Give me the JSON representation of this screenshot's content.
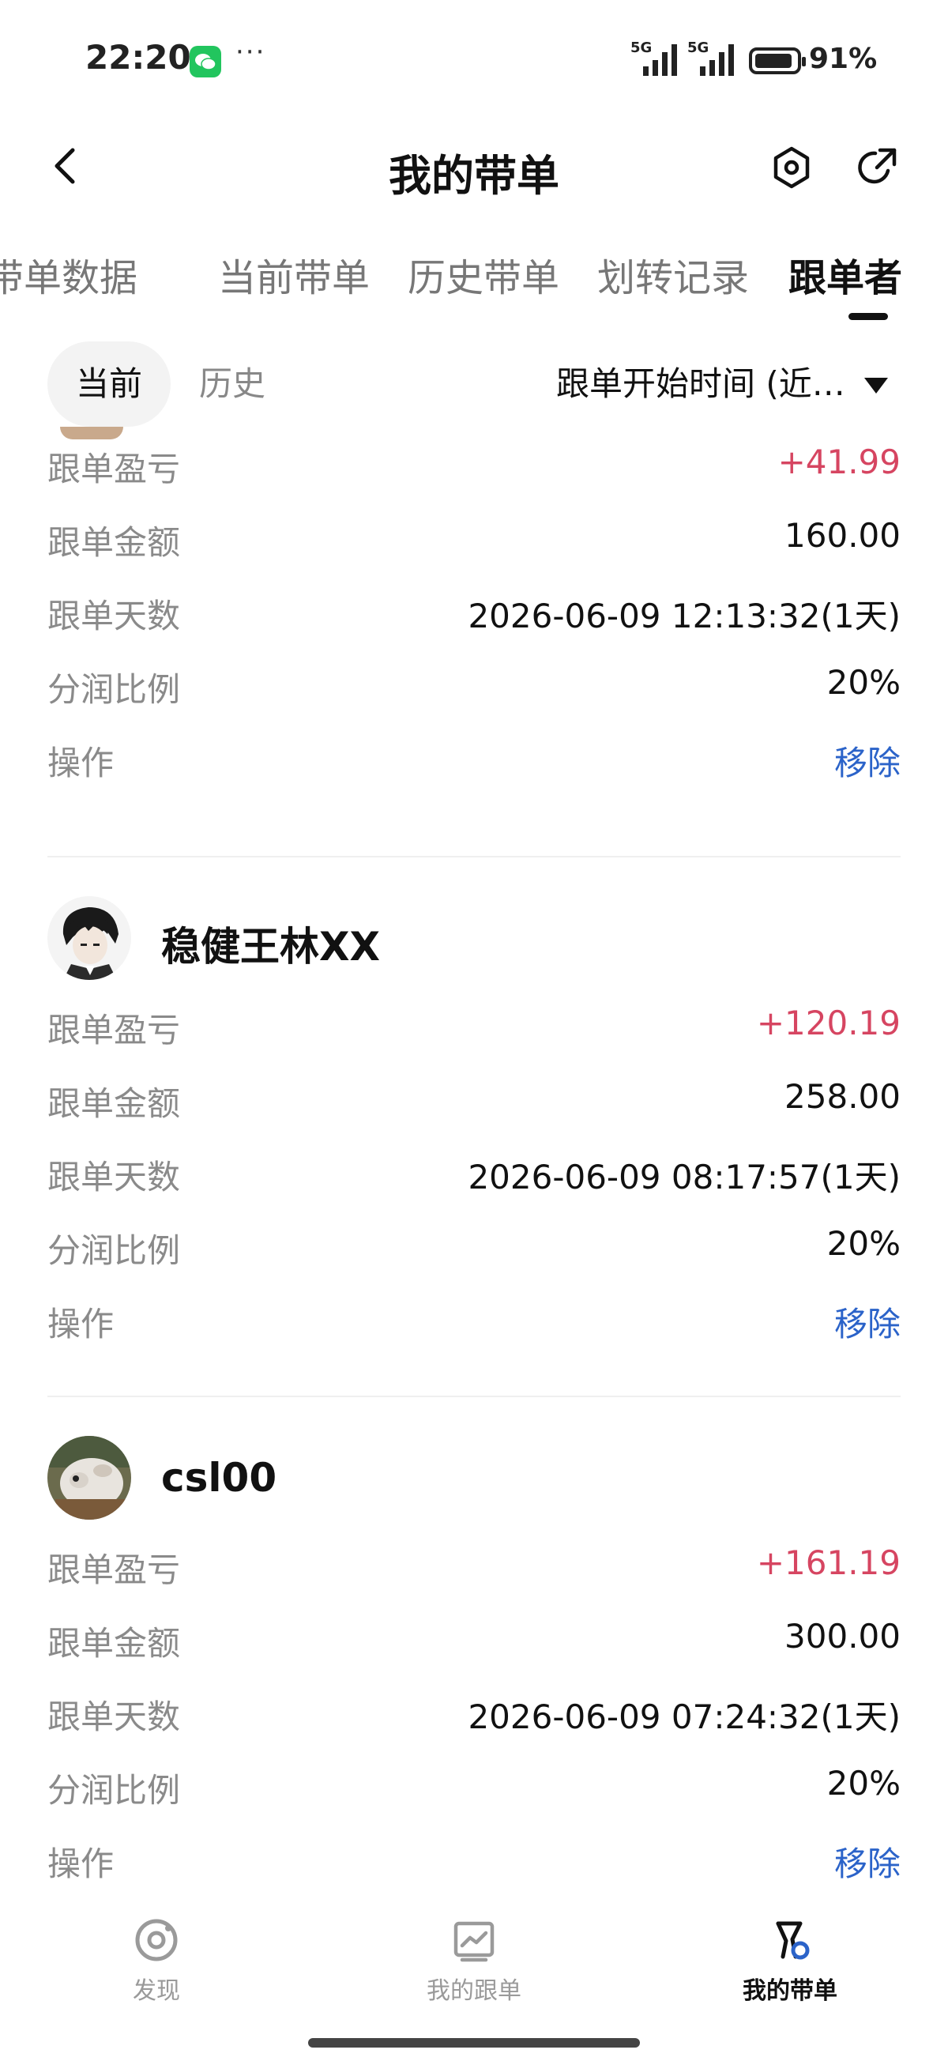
{
  "status_bar": {
    "time": "22:20",
    "dots": "···",
    "signal1_label": "5G",
    "signal2_label": "5G",
    "battery": "91%",
    "icons": [
      "wechat-icon",
      "signal-icon",
      "battery-icon"
    ]
  },
  "header": {
    "title": "我的带单",
    "icons": [
      "back-arrow-icon",
      "settings-hexagon-icon",
      "share-icon"
    ]
  },
  "tabs": [
    {
      "label": "带单数据",
      "visible_label": "带单数据"
    },
    {
      "label": "当前带单"
    },
    {
      "label": "历史带单"
    },
    {
      "label": "划转记录"
    },
    {
      "label": "跟单者",
      "active": true
    }
  ],
  "filter": {
    "current": "当前",
    "history": "历史",
    "sort": "跟单开始时间 (近…"
  },
  "followers": [
    {
      "name": "",
      "rows": [
        {
          "label": "跟单盈亏",
          "value": "+41.99"
        },
        {
          "label": "跟单金额",
          "value": "160.00"
        },
        {
          "label": "跟单天数",
          "value": "2026-06-09 12:13:32(1天)"
        },
        {
          "label": "分润比例",
          "value": "20%"
        },
        {
          "label": "操作",
          "value": "移除"
        }
      ]
    },
    {
      "name": "稳健王林XX",
      "rows": [
        {
          "label": "跟单盈亏",
          "value": "+120.19"
        },
        {
          "label": "跟单金额",
          "value": "258.00"
        },
        {
          "label": "跟单天数",
          "value": "2026-06-09 08:17:57(1天)"
        },
        {
          "label": "分润比例",
          "value": "20%"
        },
        {
          "label": "操作",
          "value": "移除"
        }
      ]
    },
    {
      "name": "csl00",
      "rows": [
        {
          "label": "跟单盈亏",
          "value": "+161.19"
        },
        {
          "label": "跟单金额",
          "value": "300.00"
        },
        {
          "label": "跟单天数",
          "value": "2026-06-09 07:24:32(1天)"
        },
        {
          "label": "分润比例",
          "value": "20%"
        },
        {
          "label": "操作",
          "value": "移除"
        }
      ]
    }
  ],
  "bottom_nav": [
    {
      "label": "发现",
      "icon": "discover-icon"
    },
    {
      "label": "我的跟单",
      "icon": "chart-icon"
    },
    {
      "label": "我的带单",
      "icon": "lead-trade-icon",
      "active": true
    }
  ],
  "colors": {
    "profit": "#d64561",
    "link": "#2b63c9",
    "label": "#8a8a8a",
    "accent_nav": "#2b63c9"
  }
}
